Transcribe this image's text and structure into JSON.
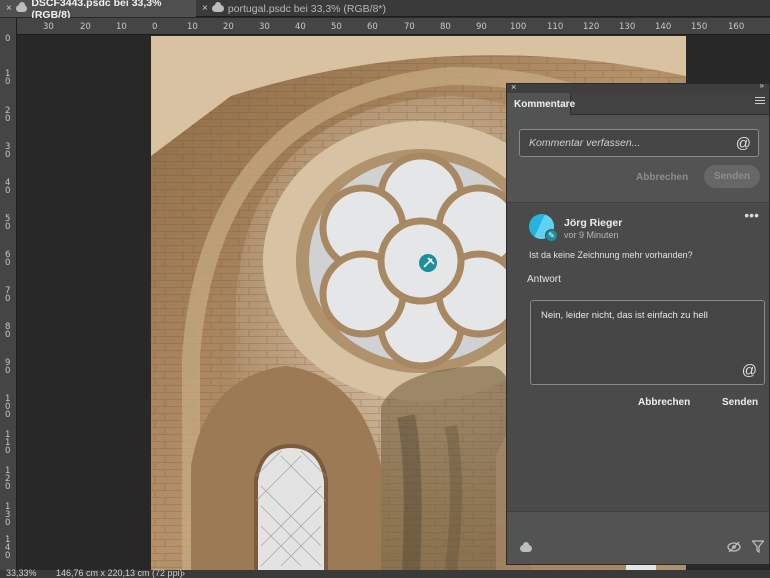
{
  "tabs": [
    {
      "label": "DSCF3443.psdc bei 33,3% (RGB/8)",
      "close": "×",
      "icon": "cloud-icon"
    },
    {
      "label": "portugal.psdc bei 33,3% (RGB/8*)",
      "close": "×",
      "icon": "cloud-icon"
    }
  ],
  "ruler_h": [
    "30",
    "20",
    "10",
    "0",
    "10",
    "20",
    "30",
    "40",
    "50",
    "60",
    "70",
    "80",
    "90",
    "100",
    "110",
    "120",
    "130",
    "140",
    "150",
    "160"
  ],
  "ruler_v": [
    "0",
    "1 0",
    "2 0",
    "3 0",
    "4 0",
    "5 0",
    "6 0",
    "7 0",
    "8 0",
    "9 0",
    "1 0 0",
    "1 1 0",
    "1 2 0",
    "1 3 0",
    "1 4 0"
  ],
  "status": {
    "zoom": "33,33%",
    "doc_size": "146,76 cm x 220,13 cm (72 ppi)",
    "arrow": "›"
  },
  "panel": {
    "close": "×",
    "collapse": "»",
    "tab_label": "Kommentare",
    "compose": {
      "placeholder": "Kommentar verfassen...",
      "at": "@"
    },
    "cancel_label": "Abbrechen",
    "send_label": "Senden",
    "comment": {
      "author": "Jörg Rieger",
      "time": "vor 9 Minuten",
      "text": "Ist da keine Zeichnung mehr vorhanden?",
      "more": "•••"
    },
    "reply": {
      "label": "Antwort",
      "value": "Nein, leider nicht, das ist einfach zu hell",
      "at": "@",
      "cancel_label": "Abbrechen",
      "send_label": "Senden"
    },
    "footer_icons": [
      "cloud-icon",
      "eye-icon",
      "filter-icon"
    ]
  },
  "colors": {
    "accent_pin": "#1c8f9c",
    "avatar": "#27b3e0",
    "panel_bg": "#535353"
  }
}
